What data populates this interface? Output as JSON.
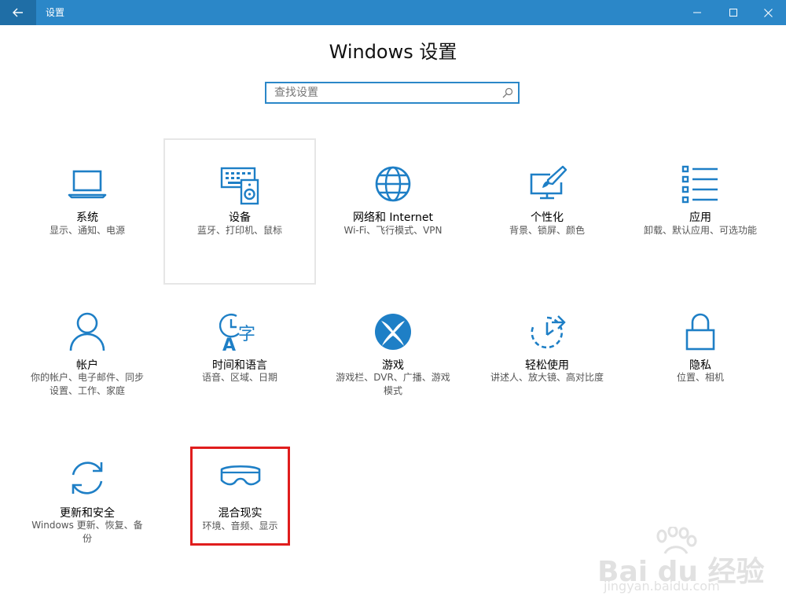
{
  "window": {
    "title": "设置",
    "accent": "#2b87c8",
    "back_dark": "#1f6ea6"
  },
  "page": {
    "title": "Windows 设置"
  },
  "search": {
    "placeholder": "查找设置"
  },
  "tiles": [
    {
      "id": "system",
      "title": "系统",
      "desc": [
        "显示、通知、电源"
      ],
      "icon": "laptop-icon"
    },
    {
      "id": "devices",
      "title": "设备",
      "desc": [
        "蓝牙、打印机、鼠标"
      ],
      "icon": "keyboard-speaker-icon"
    },
    {
      "id": "network",
      "title": "网络和 Internet",
      "desc": [
        "Wi-Fi、飞行模式、VPN"
      ],
      "icon": "globe-icon"
    },
    {
      "id": "personalization",
      "title": "个性化",
      "desc": [
        "背景、锁屏、颜色"
      ],
      "icon": "paintbrush-monitor-icon"
    },
    {
      "id": "apps",
      "title": "应用",
      "desc": [
        "卸载、默认应用、可选功能"
      ],
      "icon": "app-list-icon"
    },
    {
      "id": "accounts",
      "title": "帐户",
      "desc": [
        "你的帐户、电子邮件、同步",
        "设置、工作、家庭"
      ],
      "icon": "person-icon"
    },
    {
      "id": "time-language",
      "title": "时间和语言",
      "desc": [
        "语音、区域、日期"
      ],
      "icon": "clock-language-icon"
    },
    {
      "id": "gaming",
      "title": "游戏",
      "desc": [
        "游戏栏、DVR、广播、游戏",
        "模式"
      ],
      "icon": "xbox-icon"
    },
    {
      "id": "ease-of-access",
      "title": "轻松使用",
      "desc": [
        "讲述人、放大镜、高对比度"
      ],
      "icon": "ease-of-access-icon"
    },
    {
      "id": "privacy",
      "title": "隐私",
      "desc": [
        "位置、相机"
      ],
      "icon": "lock-icon"
    },
    {
      "id": "update-security",
      "title": "更新和安全",
      "desc": [
        "Windows 更新、恢复、备",
        "份"
      ],
      "icon": "sync-arrows-icon"
    },
    {
      "id": "mixed-reality",
      "title": "混合现实",
      "desc": [
        "环境、音频、显示"
      ],
      "icon": "vr-headset-icon"
    }
  ],
  "highlight": {
    "color": "#e01d1d"
  },
  "watermark": {
    "brand": "Bai du 经验",
    "url": "jingyan.baidu.com"
  }
}
